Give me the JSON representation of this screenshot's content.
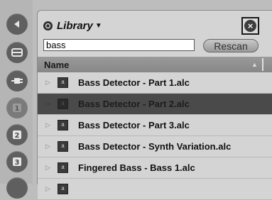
{
  "sidebar": {
    "buttons": [
      {
        "name": "back-arrow-icon"
      },
      {
        "name": "category-devices-icon"
      },
      {
        "name": "category-plugins-icon"
      },
      {
        "name": "category-clips-icon",
        "glyph": "1"
      },
      {
        "name": "category-samples-icon",
        "glyph": "2"
      },
      {
        "name": "category-packs-icon",
        "glyph": "3"
      },
      {
        "name": "category-extra-icon"
      }
    ]
  },
  "browser": {
    "title": "Library",
    "search_value": "bass",
    "rescan_label": "Rescan",
    "column_name": "Name",
    "files": [
      {
        "name": "Bass Detector - Part 1.alc",
        "selected": false
      },
      {
        "name": "Bass Detector - Part 2.alc",
        "selected": true
      },
      {
        "name": "Bass Detector - Part 3.alc",
        "selected": false
      },
      {
        "name": "Bass Detector - Synth Variation.alc",
        "selected": false
      },
      {
        "name": "Fingered Bass - Bass 1.alc",
        "selected": false
      },
      {
        "name": "",
        "selected": false
      }
    ],
    "file_icon_glyph": "a"
  },
  "colors": {
    "selected_row": "#4a4a4a",
    "panel": "#d4d4d4",
    "sidebar_button": "#5f5f5f"
  }
}
